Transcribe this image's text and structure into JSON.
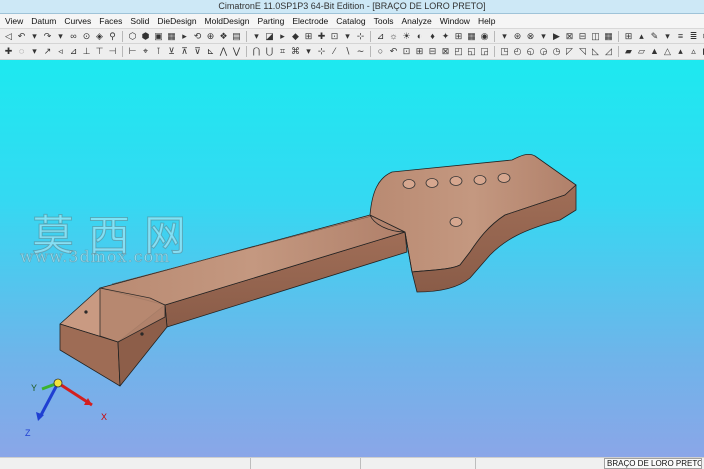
{
  "window": {
    "title": "CimatronE 11.0SP1P3 64-Bit Edition - [BRAÇO DE LORO PRETO]"
  },
  "menu": [
    "View",
    "Datum",
    "Curves",
    "Faces",
    "Solid",
    "DieDesign",
    "MoldDesign",
    "Parting",
    "Electrode",
    "Catalog",
    "Tools",
    "Analyze",
    "Window",
    "Help"
  ],
  "toolbar1": {
    "glyphs": [
      "◁",
      "↶",
      "▾",
      "↷",
      "▾",
      "∞",
      "⊙",
      "◈",
      "⚲",
      "⬡",
      "⬢",
      "▣",
      "▦",
      "▸",
      "⟲",
      "⊕",
      "❖",
      "▤",
      "▾",
      "◪",
      "▸",
      "◆",
      "⊞",
      "✚",
      "⊡",
      "▾",
      "⊹",
      "⊿",
      "☼",
      "☀",
      "◐",
      "♦",
      "✦",
      "⊞",
      "▦",
      "◉",
      "▾",
      "⊛",
      "⊗",
      "▾",
      "▶",
      "⊠",
      "⊟",
      "◫",
      "▦",
      "⊞",
      "▴",
      "✎",
      "▾",
      "≡",
      "≣",
      "⌬",
      "▾",
      "✦",
      "⊘",
      "⊙",
      "⊖",
      "◍",
      "⊛",
      "⊜",
      "⊝",
      "⊞",
      "⊟",
      "⊠",
      "⊡",
      "◧",
      "◨",
      "◩",
      "◪",
      "◫",
      "⊗",
      "▣",
      "▦"
    ]
  },
  "toolbar2": {
    "glyphs": [
      "✚",
      "◌",
      "▾",
      "↗",
      "◃",
      "⊿",
      "⊥",
      "⊤",
      "⊣",
      "⊢",
      "⌖",
      "⊺",
      "⊻",
      "⊼",
      "⊽",
      "⊾",
      "⋀",
      "⋁",
      "⋂",
      "⋃",
      "⌗",
      "⌘",
      "▾",
      "⊹",
      "⁄",
      "∖",
      "∼",
      "○",
      "↶",
      "⊡",
      "⊞",
      "⊟",
      "⊠",
      "◰",
      "◱",
      "◲",
      "◳",
      "◴",
      "◵",
      "◶",
      "◷",
      "◸",
      "◹",
      "◺",
      "◿",
      "▰",
      "▱",
      "▲",
      "△",
      "▴",
      "▵",
      "▶",
      "▷",
      "▸",
      "▹",
      "►",
      "▻",
      "▼",
      "▽",
      "▾",
      "▿",
      "◀",
      "◁",
      "◂",
      "◃",
      "◄",
      "◅",
      "◆",
      "◇",
      "◈",
      "◉",
      "◊",
      "○",
      "◌",
      "◍",
      "◎",
      "●"
    ]
  },
  "viewport": {
    "watermark_cn": "莫西网",
    "watermark_url": "www.3dmox.com",
    "axes": {
      "x": "X",
      "y": "Y",
      "z": "Z"
    }
  },
  "status": {
    "document": "BRAÇO DE LORO PRETO"
  },
  "colors": {
    "viewport_top": "#1de9f0",
    "viewport_bottom": "#8aa6e8",
    "wood": "#b07a62",
    "axis_x": "#d21f1f",
    "axis_y": "#3bb32e",
    "axis_z": "#1f3fd2"
  }
}
